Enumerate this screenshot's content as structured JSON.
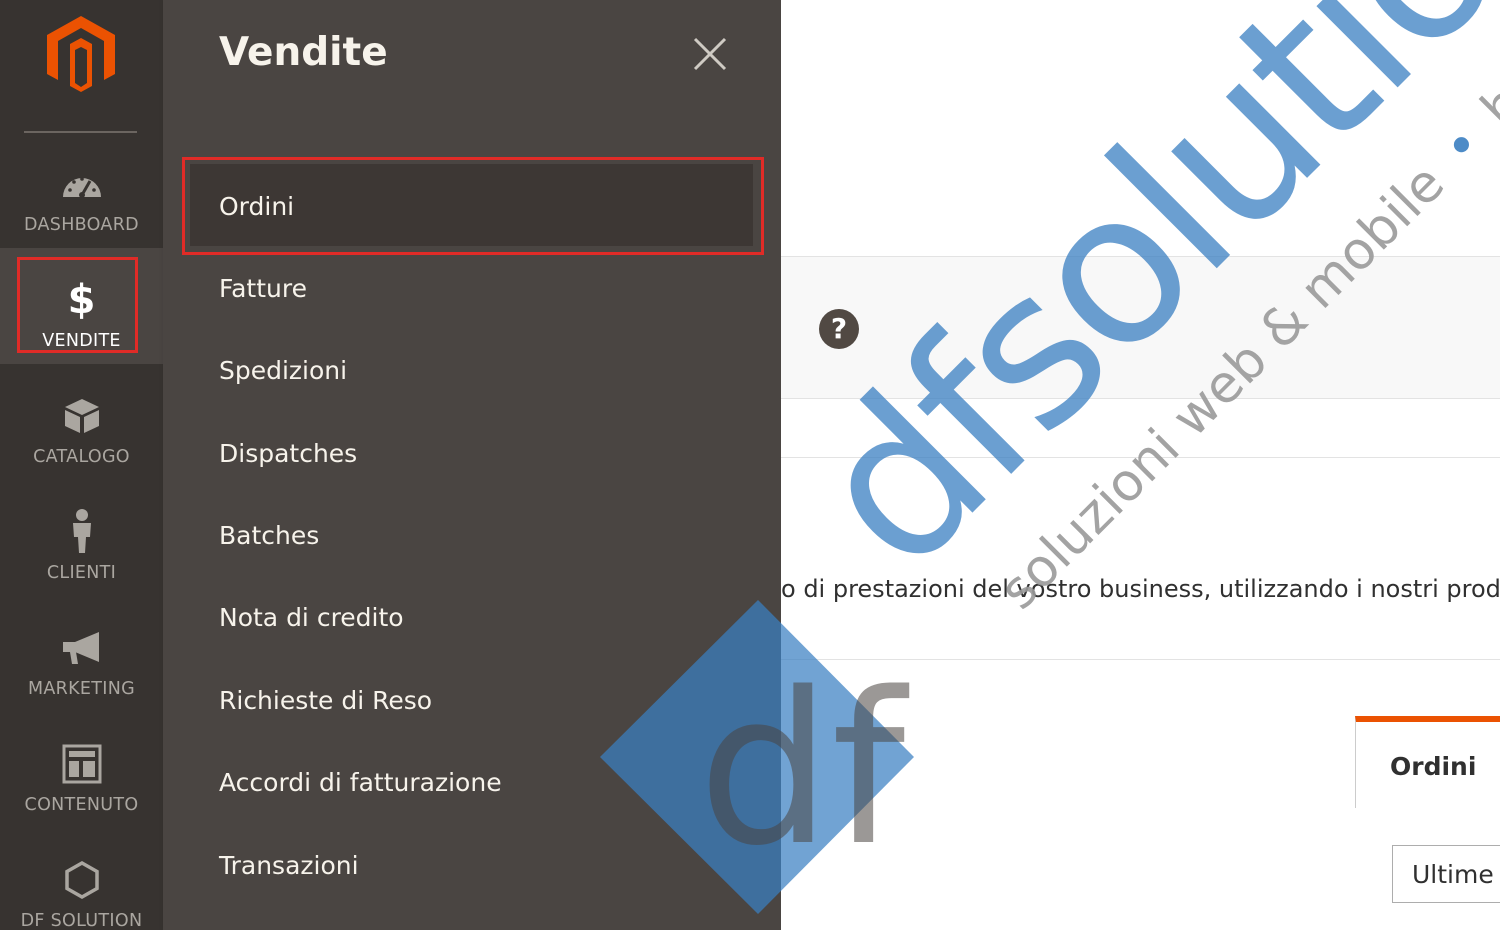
{
  "sidebar": {
    "logo_icon": "magento-logo-icon",
    "items": [
      {
        "label": "DASHBOARD",
        "icon": "speedometer-icon",
        "active": false
      },
      {
        "label": "VENDITE",
        "icon": "dollar-icon",
        "active": true
      },
      {
        "label": "CATALOGO",
        "icon": "box-icon",
        "active": false
      },
      {
        "label": "CLIENTI",
        "icon": "person-icon",
        "active": false
      },
      {
        "label": "MARKETING",
        "icon": "megaphone-icon",
        "active": false
      },
      {
        "label": "CONTENUTO",
        "icon": "layout-icon",
        "active": false
      },
      {
        "label": "DF SOLUTION",
        "icon": "hexagon-icon",
        "active": false
      }
    ]
  },
  "submenu": {
    "title": "Vendite",
    "close_icon": "close-icon",
    "items": [
      {
        "label": "Ordini",
        "selected": true
      },
      {
        "label": "Fatture"
      },
      {
        "label": "Spedizioni"
      },
      {
        "label": "Dispatches"
      },
      {
        "label": "Batches"
      },
      {
        "label": "Nota di credito"
      },
      {
        "label": "Richieste di Reso"
      },
      {
        "label": "Accordi di fatturazione"
      },
      {
        "label": "Transazioni"
      }
    ]
  },
  "content": {
    "help_label": "?",
    "message": "o di prestazioni del vostro business, utilizzando i nostri prod",
    "tab_label": "Ordini",
    "select_value": "Ultime"
  },
  "watermark": {
    "brand": "dfsolution",
    "tagline_part1": "soluzioni web & mobile",
    "bullet": "•",
    "tagline_part2": "hosting service",
    "logo_letters": "df"
  },
  "colors": {
    "rail_bg": "#373330",
    "submenu_bg": "#4a4542",
    "selected_bg": "#3d3734",
    "highlight": "#e02b27",
    "logo": "#eb5202",
    "tab_accent": "#eb5202",
    "watermark_blue": "#3a7fc2",
    "watermark_gray": "#9a9a9a"
  }
}
